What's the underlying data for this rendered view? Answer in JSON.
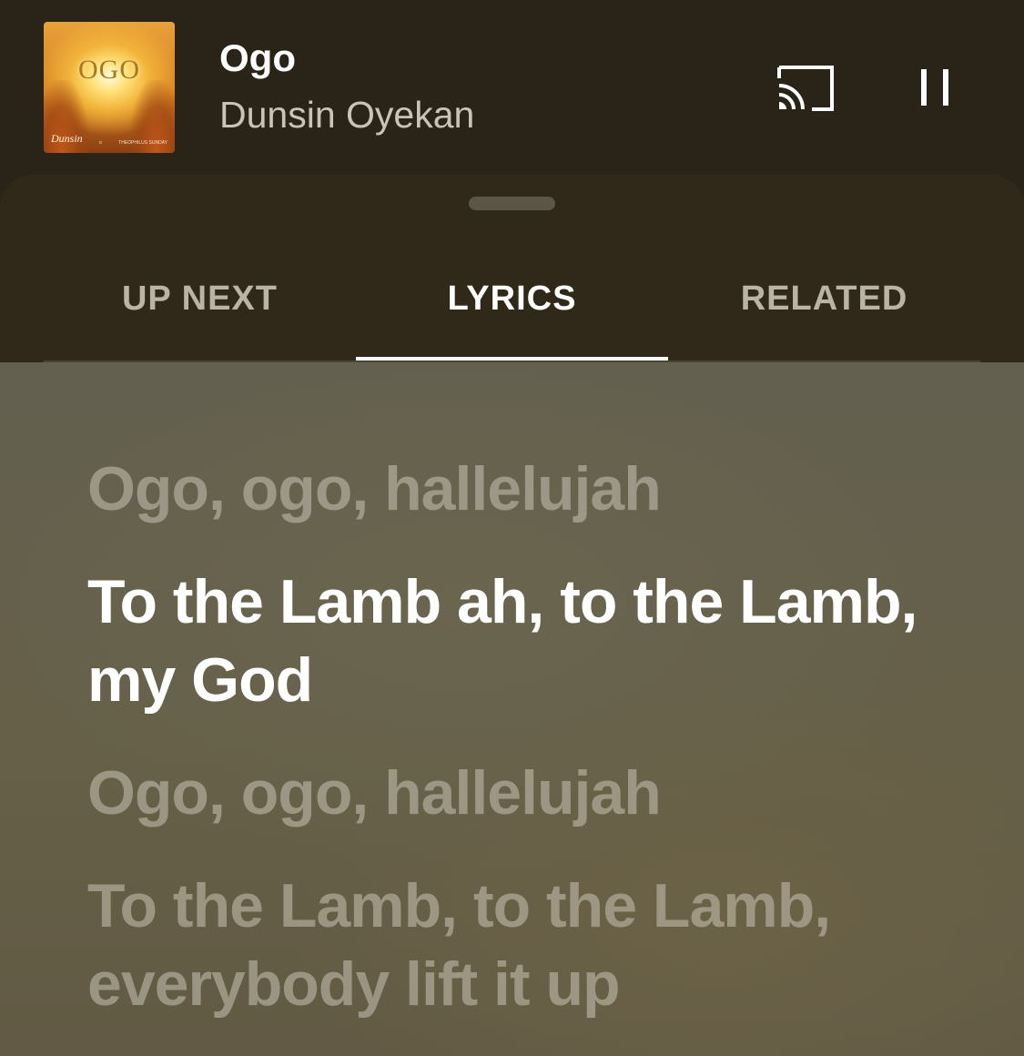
{
  "now_playing": {
    "title": "Ogo",
    "artist": "Dunsin Oyekan",
    "album_art": {
      "title_text": "OGO",
      "signature": "Dunsin",
      "ft_text": "ft",
      "feature_text": "THEOPHILUS SUNDAY"
    }
  },
  "controls": {
    "cast_icon": "cast-icon",
    "pause_icon": "pause-icon"
  },
  "tabs": [
    {
      "label": "UP NEXT",
      "active": false
    },
    {
      "label": "LYRICS",
      "active": true
    },
    {
      "label": "RELATED",
      "active": false
    }
  ],
  "lyrics": [
    {
      "text": "Ogo, ogo, hallelujah",
      "current": false
    },
    {
      "text": "To the Lamb ah, to the Lamb, my God",
      "current": true
    },
    {
      "text": "Ogo, ogo, hallelujah",
      "current": false
    },
    {
      "text": "To the Lamb, to the Lamb, everybody lift it up",
      "current": false
    }
  ],
  "colors": {
    "background": "#2a2418",
    "sheet": "#302919",
    "lyrics_bg": "#646048",
    "active_text": "#ffffff",
    "inactive_text": "#b9b4a6"
  }
}
